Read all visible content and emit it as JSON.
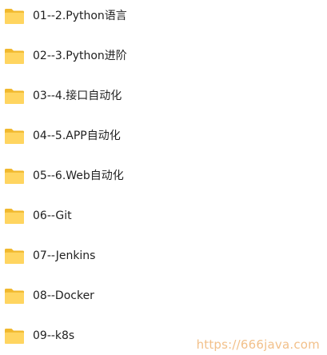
{
  "folders": [
    {
      "name": "01--2.Python语言",
      "icon": "folder-icon"
    },
    {
      "name": "02--3.Python进阶",
      "icon": "folder-icon"
    },
    {
      "name": "03--4.接口自动化",
      "icon": "folder-icon"
    },
    {
      "name": "04--5.APP自动化",
      "icon": "folder-icon"
    },
    {
      "name": "05--6.Web自动化",
      "icon": "folder-icon"
    },
    {
      "name": "06--Git",
      "icon": "folder-icon"
    },
    {
      "name": "07--Jenkins",
      "icon": "folder-icon"
    },
    {
      "name": "08--Docker",
      "icon": "folder-icon"
    },
    {
      "name": "09--k8s",
      "icon": "folder-icon"
    }
  ],
  "watermark": "https://666java.com",
  "colors": {
    "folder_back": "#f1b82d",
    "folder_front": "#ffd560",
    "text": "#1f1f1f",
    "watermark": "#f2c08a"
  }
}
